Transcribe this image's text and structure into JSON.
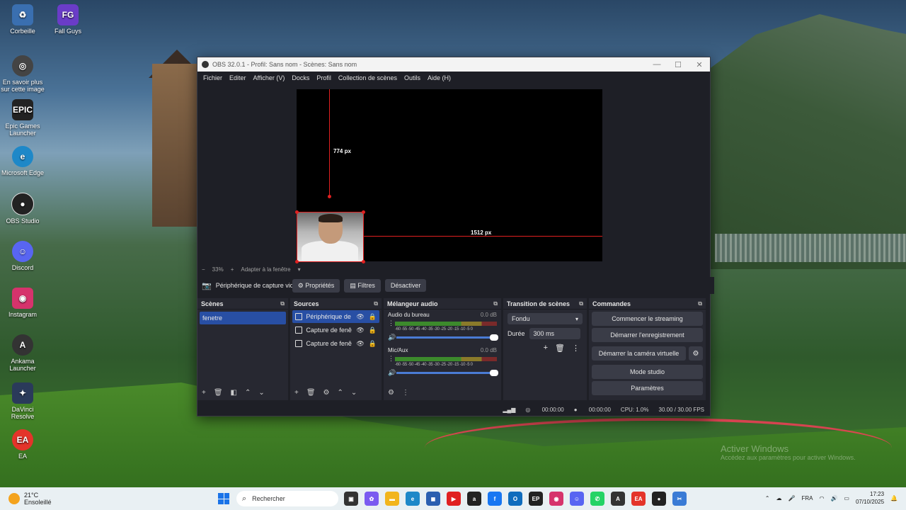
{
  "desktop": {
    "icons": [
      {
        "label": "Corbeille",
        "icon": "recycle-bin-icon",
        "color": "#3a6fb0"
      },
      {
        "label": "Fall Guys",
        "icon": "fall-guys-icon",
        "color": "#6a3cc8"
      },
      {
        "label": "En savoir plus sur cette image",
        "icon": "camera-info-icon",
        "color": "#444"
      },
      {
        "label": "Epic Games Launcher",
        "icon": "epic-games-icon",
        "color": "#222"
      },
      {
        "label": "Microsoft Edge",
        "icon": "edge-icon",
        "color": "#1e88c8"
      },
      {
        "label": "OBS Studio",
        "icon": "obs-icon",
        "color": "#222"
      },
      {
        "label": "Discord",
        "icon": "discord-icon",
        "color": "#5865f2"
      },
      {
        "label": "Instagram",
        "icon": "instagram-icon",
        "color": "#d6336c"
      },
      {
        "label": "Ankama Launcher",
        "icon": "ankama-icon",
        "color": "#333"
      },
      {
        "label": "DaVinci Resolve",
        "icon": "davinci-icon",
        "color": "#2a3a5a"
      },
      {
        "label": "EA",
        "icon": "ea-icon",
        "color": "#e4342a"
      }
    ],
    "watermark": {
      "title": "Activer Windows",
      "subtitle": "Accédez aux paramètres pour activer Windows."
    }
  },
  "obs": {
    "title": "OBS 32.0.1 - Profil: Sans nom - Scènes: Sans nom",
    "menu": [
      "Fichier",
      "Editer",
      "Afficher (V)",
      "Docks",
      "Profil",
      "Collection de scènes",
      "Outils",
      "Aide (H)"
    ],
    "preview": {
      "height_label": "774 px",
      "width_label": "1512 px"
    },
    "zoom": {
      "minus": "−",
      "value": "33%",
      "plus": "+",
      "fit": "Adapter à la fenêtre"
    },
    "source_toolbar": {
      "source_name": "Périphérique de capture vidéo",
      "properties": "Propriétés",
      "filters": "Filtres",
      "deactivate": "Désactiver"
    },
    "scenes": {
      "title": "Scènes",
      "items": [
        "fenetre"
      ]
    },
    "sources": {
      "title": "Sources",
      "items": [
        "Périphérique de capture vidéo",
        "Capture de fenêtre",
        "Capture de fenêtre"
      ]
    },
    "mixer": {
      "title": "Mélangeur audio",
      "tracks": [
        {
          "name": "Audio du bureau",
          "db": "0.0 dB"
        },
        {
          "name": "Mic/Aux",
          "db": "0.0 dB"
        }
      ],
      "scale": "-60 -55 -50 -45 -40 -35 -30 -25 -20 -15 -10 -5 0"
    },
    "transitions": {
      "title": "Transition de scènes",
      "selected": "Fondu",
      "duration_label": "Durée",
      "duration": "300 ms"
    },
    "controls": {
      "title": "Commandes",
      "start_streaming": "Commencer le streaming",
      "start_recording": "Démarrer l'enregistrement",
      "virtual_camera": "Démarrer la caméra virtuelle",
      "studio_mode": "Mode studio",
      "settings": "Paramètres"
    },
    "status": {
      "stream_time": "00:00:00",
      "rec_time": "00:00:00",
      "cpu": "CPU: 1.0%",
      "fps": "30.00 / 30.00 FPS"
    }
  },
  "taskbar": {
    "weather_temp": "21°C",
    "weather_desc": "Ensoleillé",
    "search_placeholder": "Rechercher",
    "lang": "FRA",
    "time": "17:23",
    "date": "07/10/2025"
  }
}
